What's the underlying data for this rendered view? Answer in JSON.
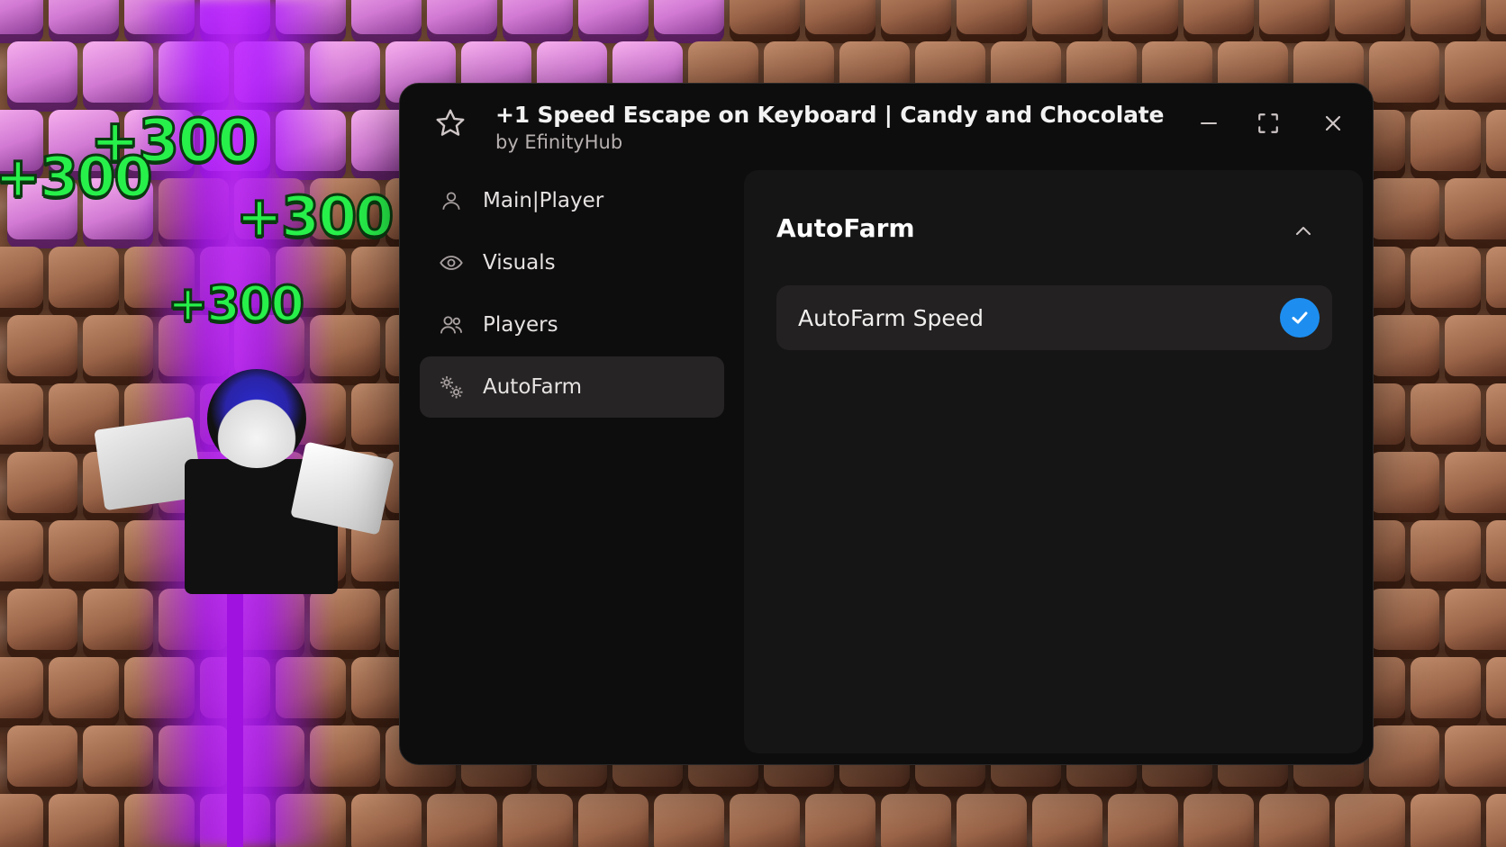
{
  "window": {
    "title": "+1 Speed Escape on Keyboard | Candy and Chocolate",
    "subtitle": "by EfinityHub",
    "icons": {
      "favorite": "star-icon",
      "minimize": "minimize-icon",
      "maximize": "maximize-icon",
      "close": "close-icon"
    }
  },
  "sidebar": {
    "items": [
      {
        "label": "Main|Player",
        "icon": "user-icon",
        "active": false
      },
      {
        "label": "Visuals",
        "icon": "eye-icon",
        "active": false
      },
      {
        "label": "Players",
        "icon": "users-icon",
        "active": false
      },
      {
        "label": "AutoFarm",
        "icon": "gears-icon",
        "active": true
      }
    ]
  },
  "content": {
    "section_title": "AutoFarm",
    "collapse_icon": "chevron-up-icon",
    "toggles": [
      {
        "label": "AutoFarm Speed",
        "checked": true
      }
    ]
  },
  "game": {
    "popups": [
      "+300",
      "+300",
      "+300",
      "+300"
    ]
  },
  "colors": {
    "window_bg": "#0e0d0d",
    "content_bg": "#161515",
    "active_nav_bg": "#262424",
    "checkbox_accent": "#1d8ef0",
    "popup_green": "#27f04a"
  }
}
